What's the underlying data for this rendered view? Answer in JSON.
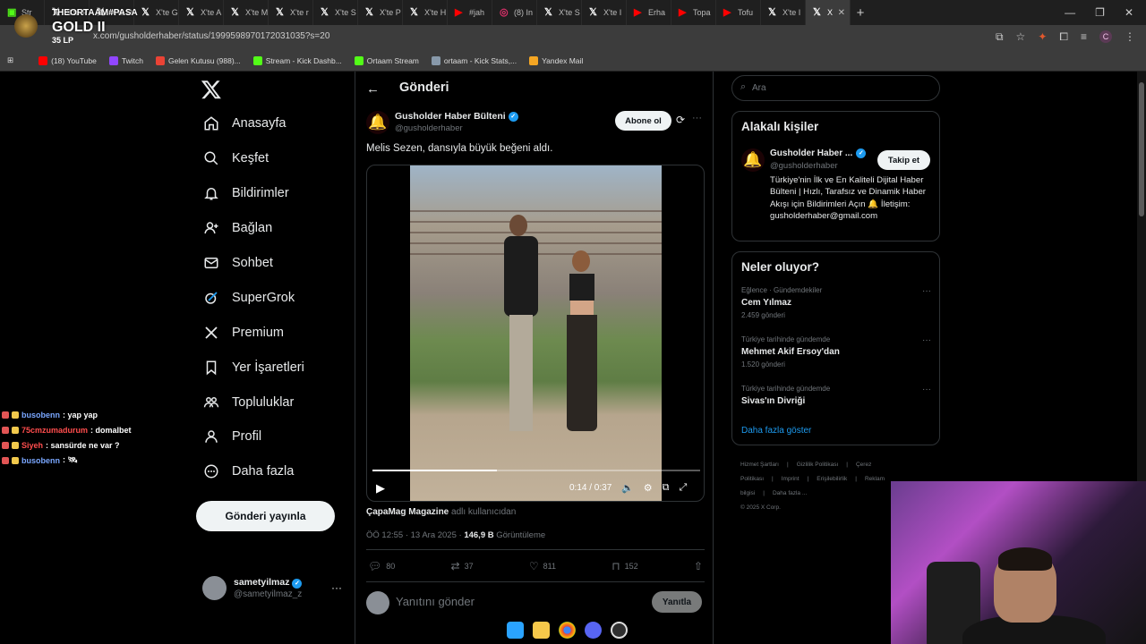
{
  "browser": {
    "tabs": [
      {
        "label": "Str",
        "icon": "tv-icon"
      },
      {
        "label": "X'te P",
        "icon": "x-icon"
      },
      {
        "label": "X'te P",
        "icon": "x-icon"
      },
      {
        "label": "X'te G",
        "icon": "x-icon"
      },
      {
        "label": "X'te A",
        "icon": "x-icon"
      },
      {
        "label": "X'te M",
        "icon": "x-icon"
      },
      {
        "label": "X'te r",
        "icon": "x-icon"
      },
      {
        "label": "X'te S",
        "icon": "x-icon"
      },
      {
        "label": "X'te P",
        "icon": "x-icon"
      },
      {
        "label": "X'te H",
        "icon": "x-icon"
      },
      {
        "label": "#jah",
        "icon": "youtube-icon"
      },
      {
        "label": "(8) In",
        "icon": "instagram-icon"
      },
      {
        "label": "X'te S",
        "icon": "x-icon"
      },
      {
        "label": "X'te I",
        "icon": "x-icon"
      },
      {
        "label": "Erha",
        "icon": "youtube-icon"
      },
      {
        "label": "Topa",
        "icon": "youtube-icon"
      },
      {
        "label": "Tofu",
        "icon": "youtube-icon"
      },
      {
        "label": "X'te I",
        "icon": "x-icon"
      },
      {
        "label": "X",
        "icon": "x-icon",
        "active": true
      }
    ],
    "new_tab": "+",
    "url": "x.com/gusholderhaber/status/1999598970172031035?s=20",
    "bookmarks": [
      {
        "label": "(18) YouTube",
        "color": "#ff0000"
      },
      {
        "label": "Twitch",
        "color": "#9146ff"
      },
      {
        "label": "Gelen Kutusu (988)...",
        "color": "#ea4335"
      },
      {
        "label": "Stream - Kick Dashb...",
        "color": "#53fc18"
      },
      {
        "label": "Ortaam Stream",
        "color": "#53fc18"
      },
      {
        "label": "ortaam - Kick Stats,...",
        "color": "#8899aa"
      },
      {
        "label": "Yandex Mail",
        "color": "#f5a623"
      }
    ]
  },
  "overlay": {
    "rank_tag": "THEORTAAM#PASA",
    "rank_tier": "GOLD II",
    "rank_lp": "35 LP",
    "chat": [
      {
        "user": "busobenn",
        "message": ": yap yap",
        "color": "#7aa7ff"
      },
      {
        "user": "75cmzumadurum",
        "message": ": domalbet",
        "color": "#ff4d4d"
      },
      {
        "user": "Siyeh",
        "message": ": sansürde ne var ?",
        "color": "#ff4d4d"
      },
      {
        "user": "busobenn",
        "message": ": 🛰",
        "color": "#7aa7ff"
      }
    ]
  },
  "nav": {
    "items": [
      {
        "label": "Anasayfa",
        "icon": "home-icon"
      },
      {
        "label": "Keşfet",
        "icon": "search-icon"
      },
      {
        "label": "Bildirimler",
        "icon": "bell-icon"
      },
      {
        "label": "Bağlan",
        "icon": "add-person-icon"
      },
      {
        "label": "Sohbet",
        "icon": "mail-icon"
      },
      {
        "label": "SuperGrok",
        "icon": "grok-icon"
      },
      {
        "label": "Premium",
        "icon": "x-icon"
      },
      {
        "label": "Yer İşaretleri",
        "icon": "bookmark-icon"
      },
      {
        "label": "Topluluklar",
        "icon": "people-icon"
      },
      {
        "label": "Profil",
        "icon": "person-icon"
      },
      {
        "label": "Daha fazla",
        "icon": "more-circle-icon"
      }
    ],
    "post_button": "Gönderi yayınla",
    "account": {
      "name": "sametyilmaz",
      "handle": "@sametyilmaz_z"
    }
  },
  "main": {
    "title": "Gönderi",
    "post": {
      "author_name": "Gusholder Haber Bülteni",
      "author_handle": "@gusholderhaber",
      "subscribe": "Abone ol",
      "text": "Melis Sezen, dansıyla büyük beğeni aldı.",
      "video": {
        "time": "0:14 / 0:37",
        "progress": 0.38
      },
      "attribution_source": "ÇapaMag Magazine",
      "attribution_suffix": " adlı kullanıcıdan",
      "time_date": "ÖÖ 12:55 · 13 Ara 2025 · ",
      "views": "146,9 B",
      "views_label": " Görüntüleme",
      "replies": "80",
      "reposts": "37",
      "likes": "811",
      "bookmarks": "152"
    },
    "reply_placeholder": "Yanıtını gönder",
    "reply_button": "Yanıtla"
  },
  "right": {
    "search_placeholder": "Ara",
    "related": {
      "title": "Alakalı kişiler",
      "name": "Gusholder Haber ...",
      "handle": "@gusholderhaber",
      "follow": "Takip et",
      "bio": "Türkiye'nin İlk ve En Kaliteli Dijital Haber Bülteni | Hızlı, Tarafsız ve Dinamik Haber Akışı için Bildirimleri Açın 🔔 İletişim: gusholderhaber@gmail.com"
    },
    "trends": {
      "title": "Neler oluyor?",
      "items": [
        {
          "category": "Eğlence · Gündemdekiler",
          "name": "Cem Yılmaz",
          "count": "2.459 gönderi"
        },
        {
          "category": "Türkiye tarihinde gündemde",
          "name": "Mehmet Akif Ersoy'dan",
          "count": "1.520 gönderi"
        },
        {
          "category": "Türkiye tarihinde gündemde",
          "name": "Sivas'ın Divriği",
          "count": ""
        }
      ],
      "show_more": "Daha fazla göster"
    },
    "footer": {
      "links": [
        "Hizmet Şartları",
        "|",
        "Gizlilik Politikası",
        "|",
        "Çerez Politikası",
        "|",
        "Imprint",
        "|",
        "Erişilebilirlik",
        "|",
        "Reklam bilgisi",
        "|",
        "Daha fazla ..."
      ],
      "copyright": "© 2025 X Corp."
    }
  }
}
